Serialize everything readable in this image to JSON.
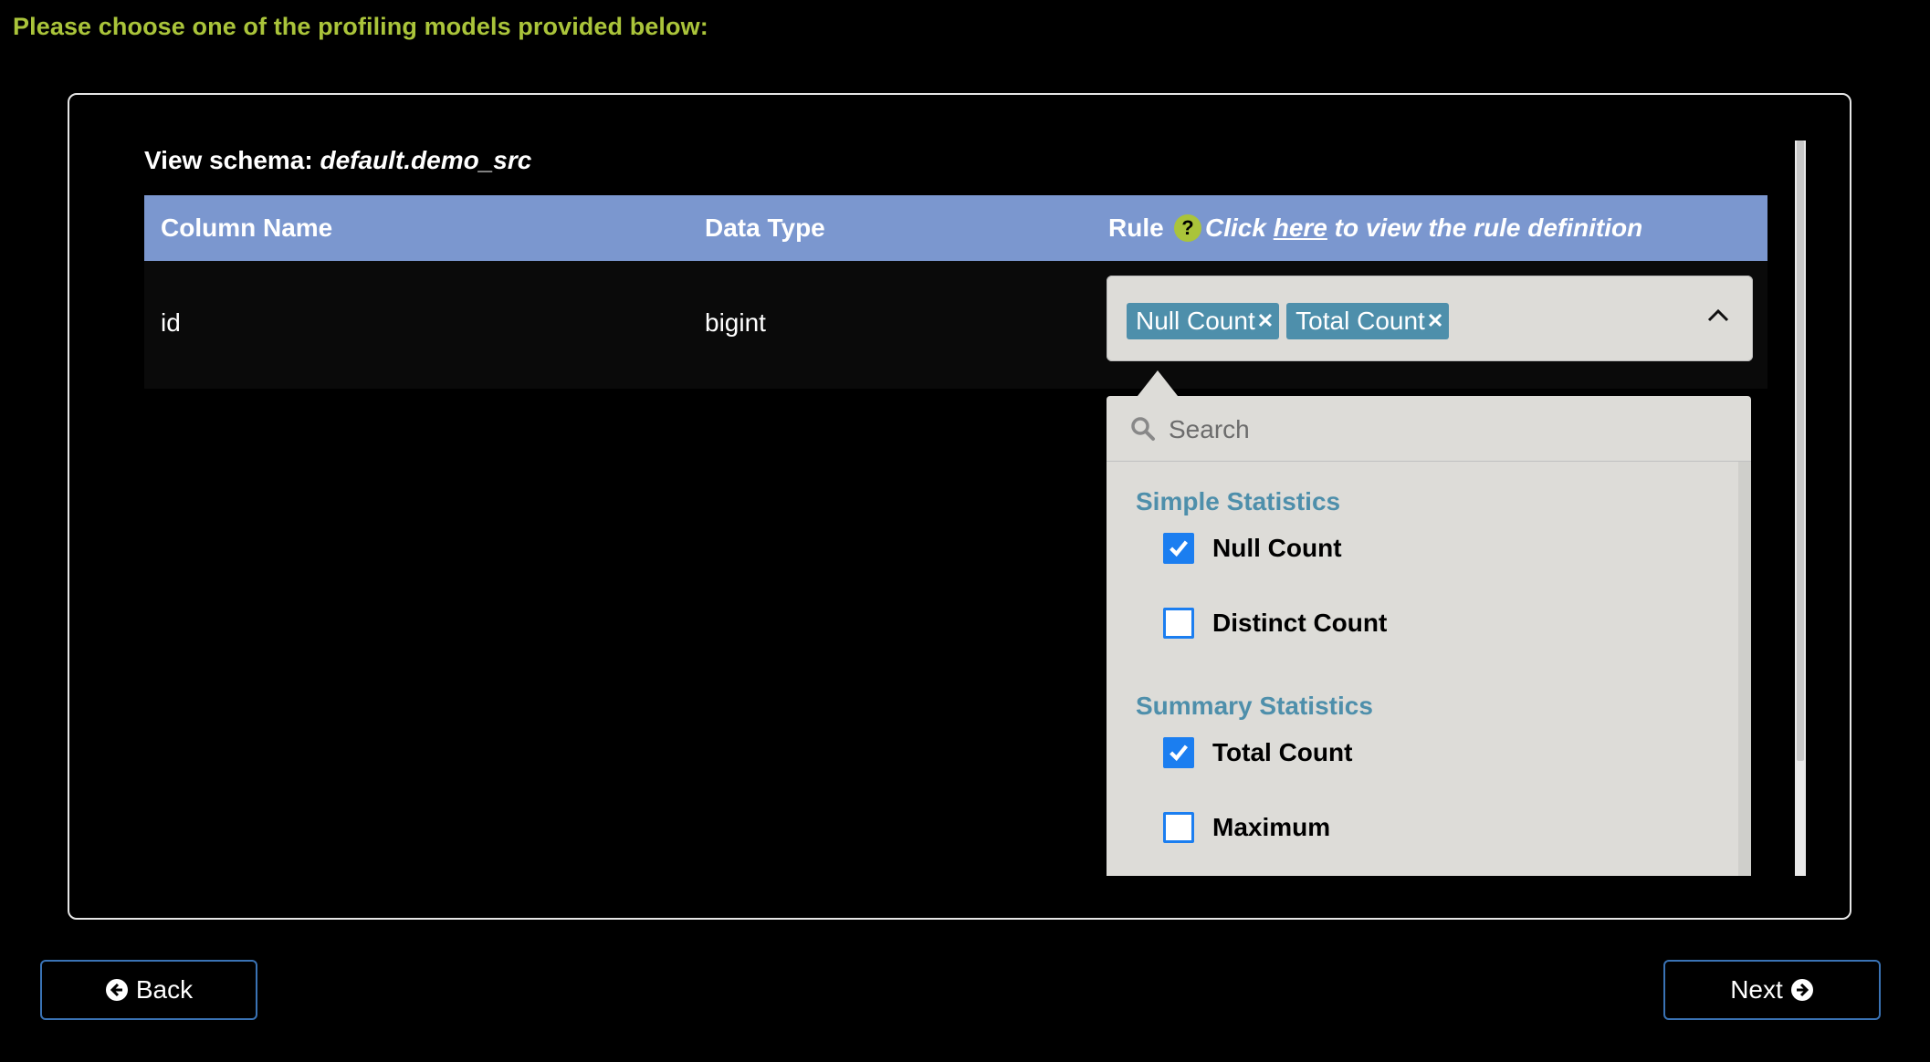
{
  "instruction": "Please choose one of the profiling models provided below:",
  "schema": {
    "label": "View schema:",
    "name": "default.demo_src"
  },
  "table": {
    "headers": {
      "column_name": "Column Name",
      "data_type": "Data Type",
      "rule": "Rule"
    },
    "rule_help": {
      "prefix": "Click",
      "link": "here",
      "suffix": "to view the rule definition",
      "icon": "question-circle-icon"
    },
    "rows": [
      {
        "column_name": "id",
        "data_type": "bigint"
      }
    ]
  },
  "rule_select": {
    "selected_tags": [
      "Null Count",
      "Total Count"
    ],
    "search_placeholder": "Search",
    "groups": [
      {
        "label": "Simple Statistics",
        "options": [
          {
            "label": "Null Count",
            "checked": true
          },
          {
            "label": "Distinct Count",
            "checked": false
          }
        ]
      },
      {
        "label": "Summary Statistics",
        "options": [
          {
            "label": "Total Count",
            "checked": true
          },
          {
            "label": "Maximum",
            "checked": false
          }
        ]
      }
    ]
  },
  "buttons": {
    "back": "Back",
    "next": "Next"
  },
  "colors": {
    "accent_green": "#aac43a",
    "header_blue": "#7b97cf",
    "tag_blue": "#4e8fab",
    "checkbox_blue": "#1b7ef0"
  }
}
